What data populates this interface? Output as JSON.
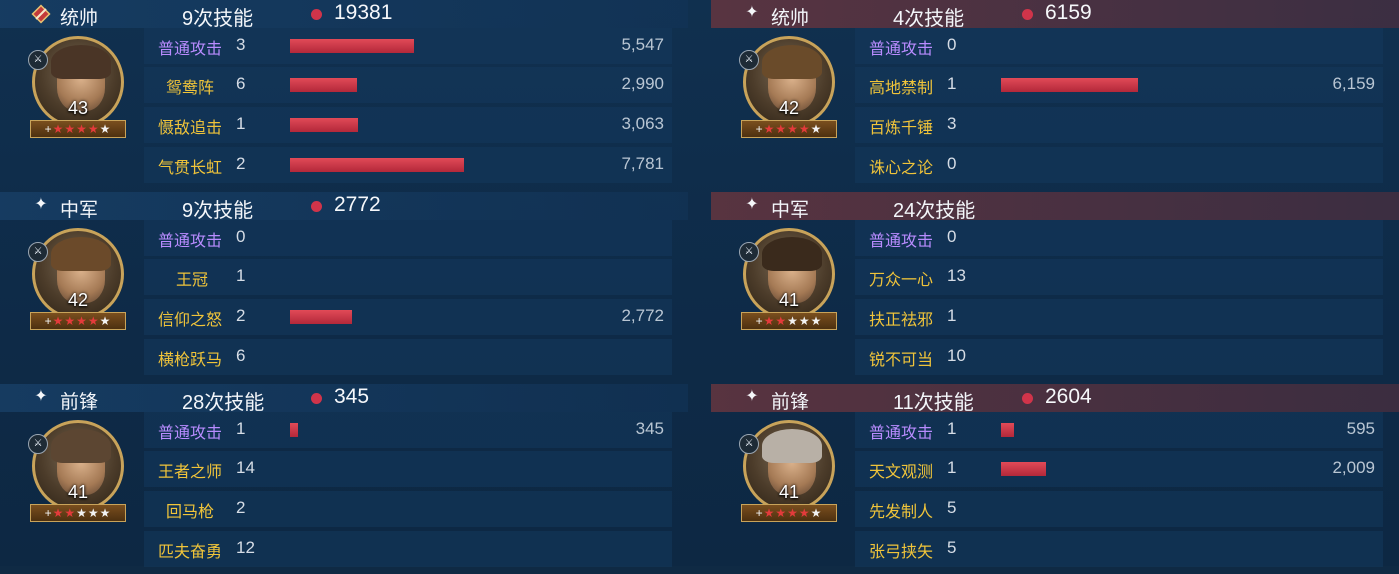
{
  "teams": [
    {
      "side": "left",
      "units": [
        {
          "role": "统帅",
          "skills": "9次技能",
          "damage": "19381",
          "level": "43",
          "stars_red": 4,
          "stars_total": 5,
          "skills_list": [
            {
              "name": "普通攻击",
              "count": "3",
              "value": "5,547",
              "bar": 124
            },
            {
              "name": "鸳鸯阵",
              "count": "6",
              "value": "2,990",
              "bar": 67
            },
            {
              "name": "慑敌追击",
              "count": "1",
              "value": "3,063",
              "bar": 68
            },
            {
              "name": "气贯长虹",
              "count": "2",
              "value": "7,781",
              "bar": 174
            }
          ]
        },
        {
          "role": "中军",
          "skills": "9次技能",
          "damage": "2772",
          "level": "42",
          "stars_red": 4,
          "stars_total": 5,
          "skills_list": [
            {
              "name": "普通攻击",
              "count": "0",
              "value": "",
              "bar": 0
            },
            {
              "name": "王冠",
              "count": "1",
              "value": "",
              "bar": 0
            },
            {
              "name": "信仰之怒",
              "count": "2",
              "value": "2,772",
              "bar": 62
            },
            {
              "name": "横枪跃马",
              "count": "6",
              "value": "",
              "bar": 0
            }
          ]
        },
        {
          "role": "前锋",
          "skills": "28次技能",
          "damage": "345",
          "level": "41",
          "stars_red": 2,
          "stars_total": 5,
          "skills_list": [
            {
              "name": "普通攻击",
              "count": "1",
              "value": "345",
              "bar": 8
            },
            {
              "name": "王者之师",
              "count": "14",
              "value": "",
              "bar": 0
            },
            {
              "name": "回马枪",
              "count": "2",
              "value": "",
              "bar": 0
            },
            {
              "name": "匹夫奋勇",
              "count": "12",
              "value": "",
              "bar": 0
            }
          ]
        }
      ]
    },
    {
      "side": "right",
      "units": [
        {
          "role": "统帅",
          "skills": "4次技能",
          "damage": "6159",
          "level": "42",
          "stars_red": 4,
          "stars_total": 5,
          "skills_list": [
            {
              "name": "普通攻击",
              "count": "0",
              "value": "",
              "bar": 0
            },
            {
              "name": "高地禁制",
              "count": "1",
              "value": "6,159",
              "bar": 137
            },
            {
              "name": "百炼千锤",
              "count": "3",
              "value": "",
              "bar": 0
            },
            {
              "name": "诛心之论",
              "count": "0",
              "value": "",
              "bar": 0
            }
          ]
        },
        {
          "role": "中军",
          "skills": "24次技能",
          "damage": "",
          "level": "41",
          "stars_red": 2,
          "stars_total": 5,
          "skills_list": [
            {
              "name": "普通攻击",
              "count": "0",
              "value": "",
              "bar": 0
            },
            {
              "name": "万众一心",
              "count": "13",
              "value": "",
              "bar": 0
            },
            {
              "name": "扶正祛邪",
              "count": "1",
              "value": "",
              "bar": 0
            },
            {
              "name": "锐不可当",
              "count": "10",
              "value": "",
              "bar": 0
            }
          ]
        },
        {
          "role": "前锋",
          "skills": "11次技能",
          "damage": "2604",
          "level": "41",
          "stars_red": 4,
          "stars_total": 5,
          "skills_list": [
            {
              "name": "普通攻击",
              "count": "1",
              "value": "595",
              "bar": 13
            },
            {
              "name": "天文观测",
              "count": "1",
              "value": "2,009",
              "bar": 45
            },
            {
              "name": "先发制人",
              "count": "5",
              "value": "",
              "bar": 0
            },
            {
              "name": "张弓挟矢",
              "count": "5",
              "value": "",
              "bar": 0
            }
          ]
        }
      ]
    }
  ],
  "colors": {
    "normal_attack": "#b98cff",
    "skill_name": "#f0c43a",
    "bar": "#d63a4b",
    "damage_dot": "#d0344a"
  },
  "icons": {
    "commander": "commander-sword-icon",
    "other": "sparkle-icon",
    "badge": "troop-type-icon"
  }
}
